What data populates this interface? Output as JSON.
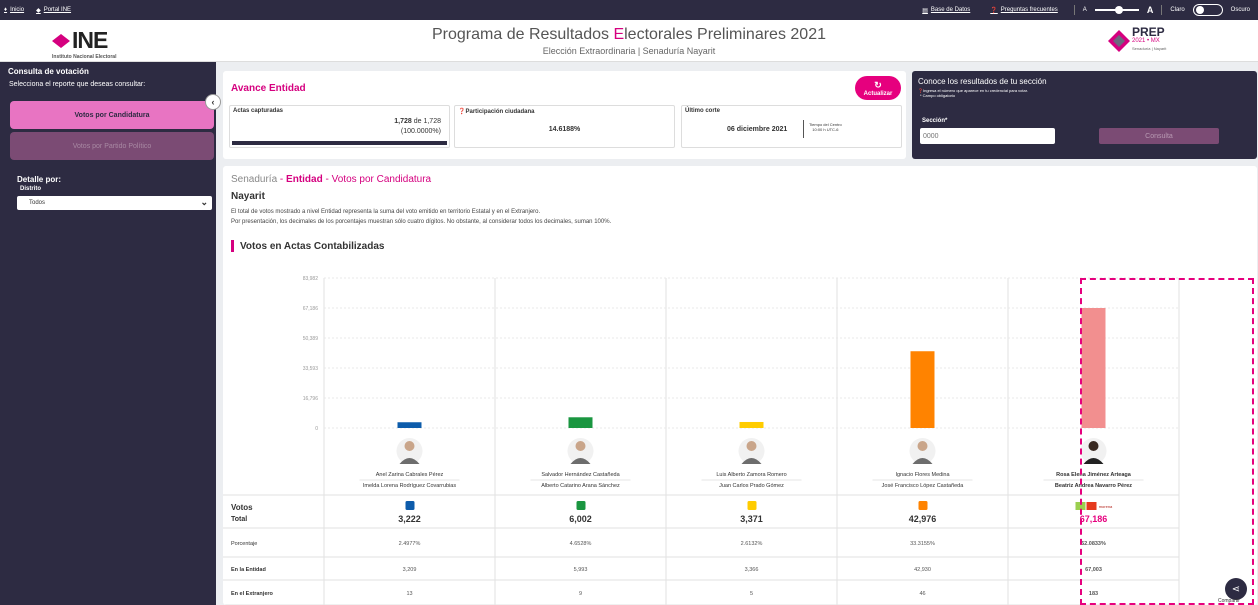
{
  "topbar": {
    "inicio": "Inicio",
    "portal": "Portal INE",
    "base_datos": "Base de Datos",
    "preguntas": "Preguntas frecuentes",
    "font_small": "A",
    "font_large": "A",
    "claro": "Claro",
    "oscuro": "Oscuro"
  },
  "header": {
    "logo_text": "INE",
    "logo_sub": "Instituto Nacional Electoral",
    "title_pre": "Programa de Resultados ",
    "title_accent": "E",
    "title_post": "lectorales Preliminares 2021",
    "subtitle": "Elección Extraordinaria | Senaduría Nayarit",
    "prep_logo": "PREP",
    "prep_sub": "2021 • MX",
    "prep_sub2": "Senaduría | Nayarit"
  },
  "sidebar": {
    "heading": "Consulta de votación",
    "subheading": "Selecciona el reporte que deseas consultar:",
    "btn_candidatura": "Votos por Candidatura",
    "btn_partido": "Votos por Partido Político",
    "detalle": "Detalle por:",
    "distrito": "Distrito",
    "distrito_value": "Todos"
  },
  "avance": {
    "title": "Avance Entidad",
    "refresh": "Actualizar",
    "actas_label": "Actas capturadas",
    "actas_value": "1,728",
    "actas_de": "de",
    "actas_total": "1,728",
    "actas_pct": "(100.0000%)",
    "actas_progress": 1.0,
    "participacion_label": "Participación ciudadana",
    "participacion_value": "14.6188%",
    "corte_label": "Último corte",
    "corte_date": "06 diciembre 2021",
    "corte_tz1": "Tiempo del Centro",
    "corte_tz2": "10:00 h UTC-6"
  },
  "consulta": {
    "title": "Conoce los resultados de tu sección",
    "note1": "Ingresa el número que aparece en tu credencial para votar.",
    "note2": "* Campo obligatorio",
    "seccion_label": "Sección*",
    "seccion_placeholder": "0000",
    "button": "Consulta"
  },
  "main": {
    "breadcrumb_1": "Senaduría",
    "breadcrumb_sep": " - ",
    "breadcrumb_2": "Entidad",
    "breadcrumb_3": "Votos por Candidatura",
    "place": "Nayarit",
    "note1": "El total de votos mostrado a nivel Entidad representa la suma del voto emitido en territorio Estatal y en el Extranjero.",
    "note2": "Por presentación, los decimales de los porcentajes muestran sólo cuatro dígitos. No obstante, al considerar todos los decimales, suman 100%.",
    "section_title": "Votos en Actas Contabilizadas",
    "row_votos": "Votos",
    "row_total": "Total",
    "row_porcentaje": "Porcentaje",
    "row_entidad": "En la Entidad",
    "row_extranjero": "En el Extranjero"
  },
  "chart_data": {
    "type": "bar",
    "yticks": [
      "83,982",
      "67,186",
      "50,389",
      "33,593",
      "16,796",
      "0"
    ],
    "ylim": [
      0,
      83982
    ],
    "categories": [
      "Anel Zarina Cabrales Pérez / Imelda Lorena Rodríguez Covarrubias",
      "Salvador Hernández Castañeda / Alberto Catarino Arana Sánchez",
      "Luis Alberto Zamora Romero / Juan Carlos Prado Gómez",
      "Ignacio Flores Medina / José Francisco López Castañeda",
      "Rosa Elena Jiménez Arteaga / Beatriz Andrea Navarro Pérez"
    ],
    "values": [
      3222,
      6002,
      3371,
      42976,
      67186
    ],
    "candidates": [
      {
        "name1": "Anel Zarina Cabrales Pérez",
        "name2": "Imelda Lorena Rodríguez Covarrubias",
        "color": "#0d5cab",
        "total": "3,222",
        "pct": "2.4977%",
        "entidad": "3,209",
        "extranjero": "13",
        "party_icon": "pan-icon"
      },
      {
        "name1": "Salvador Hernández Castañeda",
        "name2": "Alberto Catarino Arana Sánchez",
        "color": "#1a9640",
        "total": "6,002",
        "pct": "4.6528%",
        "entidad": "5,993",
        "extranjero": "9",
        "party_icon": "pri-icon"
      },
      {
        "name1": "Luis Alberto Zamora Romero",
        "name2": "Juan Carlos Prado Gómez",
        "color": "#ffcc00",
        "total": "3,371",
        "pct": "2.6132%",
        "entidad": "3,366",
        "extranjero": "5",
        "party_icon": "prd-icon"
      },
      {
        "name1": "Ignacio Flores Medina",
        "name2": "José Francisco López Castañeda",
        "color": "#ff8300",
        "total": "42,976",
        "pct": "33.3155%",
        "entidad": "42,930",
        "extranjero": "46",
        "party_icon": "mc-icon"
      },
      {
        "name1": "Rosa Elena Jiménez Arteaga",
        "name2": "Beatriz Andrea Navarro Pérez",
        "color": "#f28f8f",
        "total": "67,186",
        "pct": "52.0833%",
        "entidad": "67,003",
        "extranjero": "183",
        "party_icon": "morena-coalition-icon"
      }
    ]
  },
  "fab": {
    "label": "Compartir"
  }
}
